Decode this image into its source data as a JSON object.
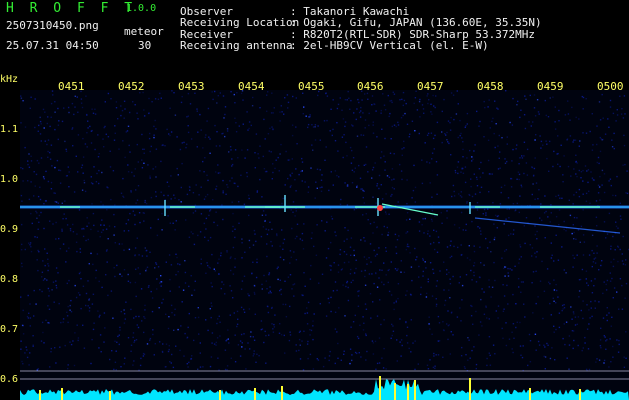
{
  "app": {
    "brand": "H R O F F T",
    "version": "1.0.0"
  },
  "file": {
    "name": "2507310450.png",
    "datetime": "25.07.31 04:50"
  },
  "detection": {
    "label": "meteor",
    "count": "30"
  },
  "station": {
    "observer_key": "Observer",
    "observer_val": ": Takanori Kawachi",
    "location_key": "Receiving Location",
    "location_val": ": Ogaki, Gifu, JAPAN (136.60E, 35.35N)",
    "receiver_key": "Receiver",
    "receiver_val": ": R820T2(RTL-SDR) SDR-Sharp 53.372MHz",
    "antenna_key": "Receiving antenna",
    "antenna_val": ": 2el-HB9CV Vertical (el. E-W)"
  },
  "axis": {
    "unit": "kHz",
    "y_ticks": [
      "1.1",
      "1.0",
      "0.9",
      "0.8",
      "0.7",
      "0.6"
    ],
    "x_ticks": [
      "0451",
      "0452",
      "0453",
      "0454",
      "0455",
      "0456",
      "0457",
      "0458",
      "0459",
      "0500"
    ]
  },
  "colors": {
    "background": "#000000",
    "noise": "#0a1a8c",
    "carrier": "#33bbff",
    "label": "#ffff66",
    "text": "#f0f0f0",
    "brand": "#33ee33"
  }
}
